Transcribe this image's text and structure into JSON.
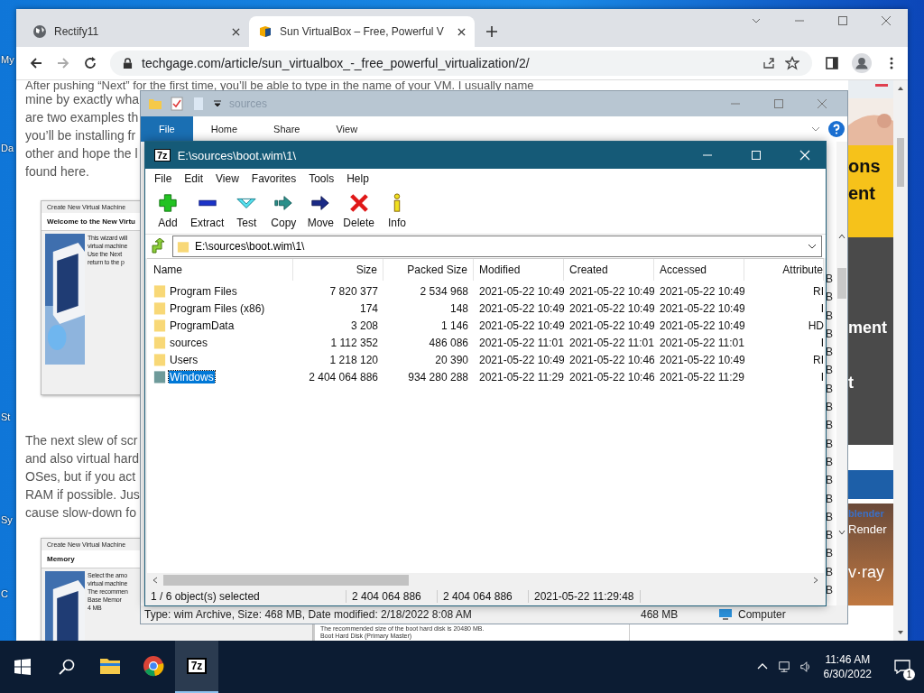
{
  "desktop": {
    "icon_labels": [
      "My",
      "Da",
      "St",
      "Sy",
      "C"
    ]
  },
  "browser": {
    "tabs": [
      {
        "title": "Rectify11",
        "kind": "globe",
        "selected": false
      },
      {
        "title": "Sun VirtualBox – Free, Powerful V",
        "kind": "cube",
        "selected": true
      }
    ],
    "url": "techgage.com/article/sun_virtualbox_-_free_powerful_virtualization/2/",
    "paragraphs": [
      [
        "After pushing “Next” for the first time, you’ll be able to type in the name of your VM. I usually name",
        "mine by exactly wha",
        "are two examples th",
        "you’ll be installing fr",
        "other and hope the l",
        "found here."
      ],
      [
        "The next slew of scr",
        "and also virtual hard",
        "OSes, but if you act",
        "RAM if possible. Jus",
        "cause slow-down fo"
      ]
    ],
    "screenshots": [
      {
        "title": "Create New Virtual Machine",
        "heading": "Welcome to the New Virtu",
        "lines": [
          "This wizard will",
          "virtual machine",
          "Use the Next",
          "return to the p"
        ]
      },
      {
        "title": "Create New Virtual Machine",
        "heading": "Memory",
        "lines": [
          "Select the amo",
          "virtual machine",
          "The recommen",
          "Base Memor",
          "4 MB"
        ]
      }
    ],
    "bottom_snippet": [
      "The recommended size of the boot hard disk is 20480 MB.",
      "Boot Hard Disk (Primary Master)"
    ],
    "ads": [
      {
        "kind": "yellow",
        "lines": [
          "ons",
          "ent"
        ]
      },
      {
        "kind": "dark",
        "lines": [
          "ment",
          "t"
        ]
      },
      {
        "kind": "render",
        "lines": [
          "blender",
          "Render",
          "v·ray"
        ]
      }
    ]
  },
  "explorer": {
    "title": "sources",
    "ribbon_tabs": [
      {
        "label": "File",
        "selected": true
      },
      {
        "label": "Home",
        "selected": false
      },
      {
        "label": "Share",
        "selected": false
      },
      {
        "label": "View",
        "selected": false
      }
    ],
    "side_marks": [
      "B",
      "B",
      "B",
      "B",
      "B",
      "B",
      "B",
      "B",
      "B",
      "B",
      "B",
      "B",
      "B",
      "B",
      "B",
      "B",
      "B",
      "B"
    ],
    "status": {
      "details": "Type: wim Archive, Size: 468 MB, Date modified: 2/18/2022 8:08 AM",
      "size": "468 MB",
      "location": "Computer"
    }
  },
  "sevenzip": {
    "logo": "7z",
    "title": "E:\\sources\\boot.wim\\1\\",
    "menu": [
      "File",
      "Edit",
      "View",
      "Favorites",
      "Tools",
      "Help"
    ],
    "toolbar": [
      {
        "label": "Add",
        "kind": "add"
      },
      {
        "label": "Extract",
        "kind": "extract"
      },
      {
        "label": "Test",
        "kind": "test"
      },
      {
        "label": "Copy",
        "kind": "copy"
      },
      {
        "label": "Move",
        "kind": "move"
      },
      {
        "label": "Delete",
        "kind": "delete"
      },
      {
        "label": "Info",
        "kind": "info"
      }
    ],
    "path": "E:\\sources\\boot.wim\\1\\",
    "columns": [
      "Name",
      "Size",
      "Packed Size",
      "Modified",
      "Created",
      "Accessed",
      "Attribute"
    ],
    "rows": [
      {
        "name": "Program Files",
        "size": "7 820 377",
        "packed": "2 534 968",
        "modified": "2021-05-22 10:49",
        "created": "2021-05-22 10:49",
        "accessed": "2021-05-22 10:49",
        "attributes": "RI",
        "selected": false
      },
      {
        "name": "Program Files (x86)",
        "size": "174",
        "packed": "148",
        "modified": "2021-05-22 10:49",
        "created": "2021-05-22 10:49",
        "accessed": "2021-05-22 10:49",
        "attributes": "I",
        "selected": false
      },
      {
        "name": "ProgramData",
        "size": "3 208",
        "packed": "1 146",
        "modified": "2021-05-22 10:49",
        "created": "2021-05-22 10:49",
        "accessed": "2021-05-22 10:49",
        "attributes": "HD",
        "selected": false
      },
      {
        "name": "sources",
        "size": "1 112 352",
        "packed": "486 086",
        "modified": "2021-05-22 11:01",
        "created": "2021-05-22 11:01",
        "accessed": "2021-05-22 11:01",
        "attributes": "I",
        "selected": false
      },
      {
        "name": "Users",
        "size": "1 218 120",
        "packed": "20 390",
        "modified": "2021-05-22 10:49",
        "created": "2021-05-22 10:46",
        "accessed": "2021-05-22 10:49",
        "attributes": "RI",
        "selected": false
      },
      {
        "name": "Windows",
        "size": "2 404 064 886",
        "packed": "934 280 288",
        "modified": "2021-05-22 11:29",
        "created": "2021-05-22 10:46",
        "accessed": "2021-05-22 11:29",
        "attributes": "I",
        "selected": true
      }
    ],
    "status": [
      "1 / 6 object(s) selected",
      "2 404 064 886",
      "2 404 064 886",
      "2021-05-22 11:29:48"
    ]
  },
  "taskbar": {
    "apps": [
      {
        "kind": "explorer",
        "active": false
      },
      {
        "kind": "chrome",
        "active": false
      },
      {
        "kind": "sevenzip",
        "label": "7z",
        "active": true
      }
    ],
    "time": "11:46 AM",
    "date": "6/30/2022",
    "notifications": "1"
  }
}
